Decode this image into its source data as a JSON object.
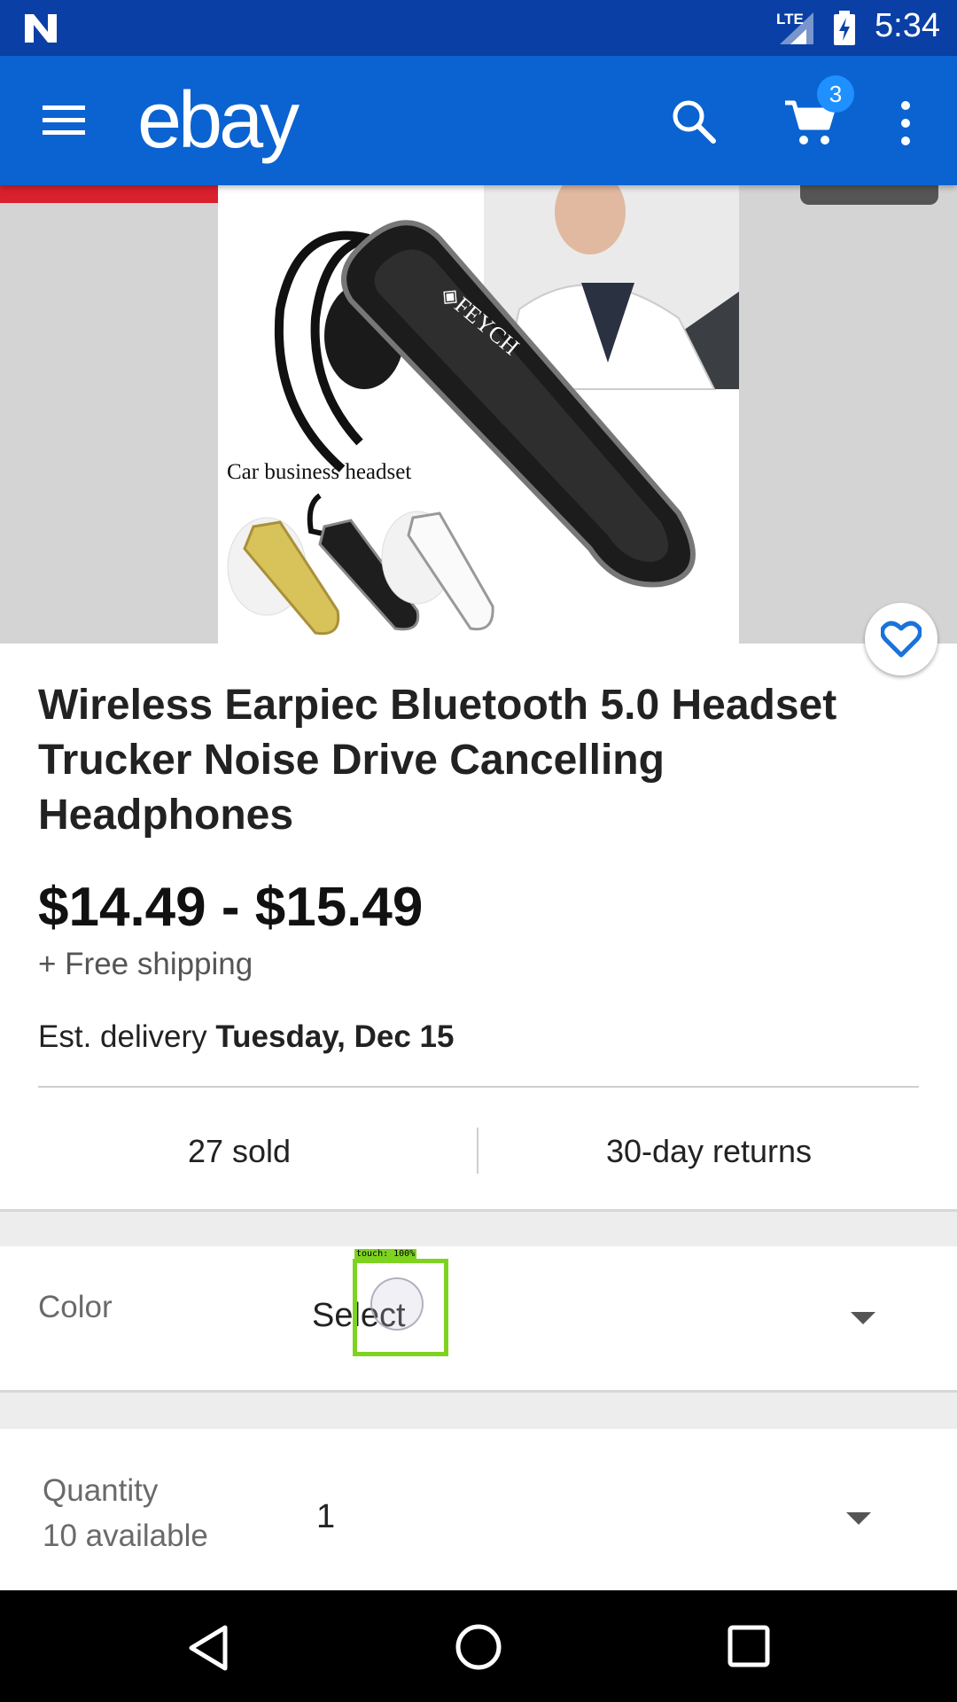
{
  "status_bar": {
    "network": "LTE",
    "time": "5:34"
  },
  "app_bar": {
    "logo": "ebay",
    "cart_count": "3"
  },
  "hero": {
    "caption": "Car business headset"
  },
  "listing": {
    "title": "Wireless Earpiec Bluetooth 5.0 Headset Trucker Noise Drive Cancelling Headphones",
    "price": "$14.49 - $15.49",
    "shipping": "+ Free shipping",
    "delivery_prefix": "Est. delivery ",
    "delivery_date": "Tuesday, Dec 15",
    "sold": "27 sold",
    "returns": "30-day returns"
  },
  "options": {
    "color": {
      "label": "Color",
      "value": "Select"
    },
    "quantity": {
      "label": "Quantity",
      "sub": "10 available",
      "value": "1"
    }
  },
  "touch_indicator": {
    "label": "touch: 100%"
  },
  "colors": {
    "status_bar": "#0a3fa5",
    "app_bar": "#0a63d0",
    "badge": "#1e90ff",
    "favorite": "#1a73d9",
    "touch": "#7ed321"
  }
}
